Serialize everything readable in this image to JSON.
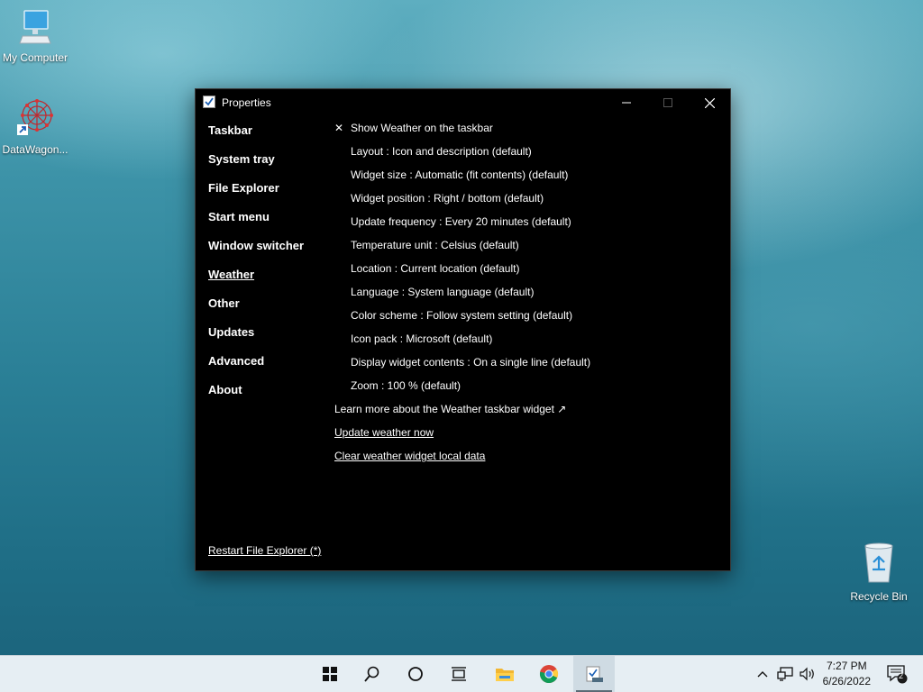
{
  "desktop": {
    "icons": [
      {
        "label": "My Computer",
        "icon": "computer-icon"
      },
      {
        "label": "DataWagon...",
        "icon": "datawagon-shortcut-icon"
      },
      {
        "label": "Recycle Bin",
        "icon": "recycle-bin-icon"
      }
    ]
  },
  "window": {
    "title": "Properties",
    "nav": [
      "Taskbar",
      "System tray",
      "File Explorer",
      "Start menu",
      "Window switcher",
      "Weather",
      "Other",
      "Updates",
      "Advanced",
      "About"
    ],
    "active_nav": "Weather",
    "settings": {
      "show_weather": {
        "check": "✕",
        "label": "Show Weather on the taskbar"
      },
      "items": [
        "Layout : Icon and description (default)",
        "Widget size : Automatic (fit contents) (default)",
        "Widget position : Right / bottom (default)",
        "Update frequency : Every 20 minutes (default)",
        "Temperature unit : Celsius (default)",
        "Location : Current location (default)",
        "Language : System language (default)",
        "Color scheme : Follow system setting (default)",
        "Icon pack : Microsoft (default)",
        "Display widget contents : On a single line (default)",
        "Zoom : 100 % (default)"
      ],
      "learn_more": "Learn more about the Weather taskbar widget ↗",
      "update_now": "Update weather now",
      "clear_data": "Clear weather widget local data"
    },
    "restart": "Restart File Explorer (*)"
  },
  "taskbar": {
    "buttons": [
      "start-icon",
      "search-icon",
      "cortana-icon",
      "task-view-icon",
      "file-explorer-icon",
      "chrome-icon",
      "explorer-patcher-properties-icon"
    ],
    "time": "7:27 PM",
    "date": "6/26/2022",
    "notifications": "2"
  },
  "colors": {
    "window_bg": "#000000",
    "taskbar_bg": "#e6eef3",
    "desktop": "#2a7f96"
  }
}
